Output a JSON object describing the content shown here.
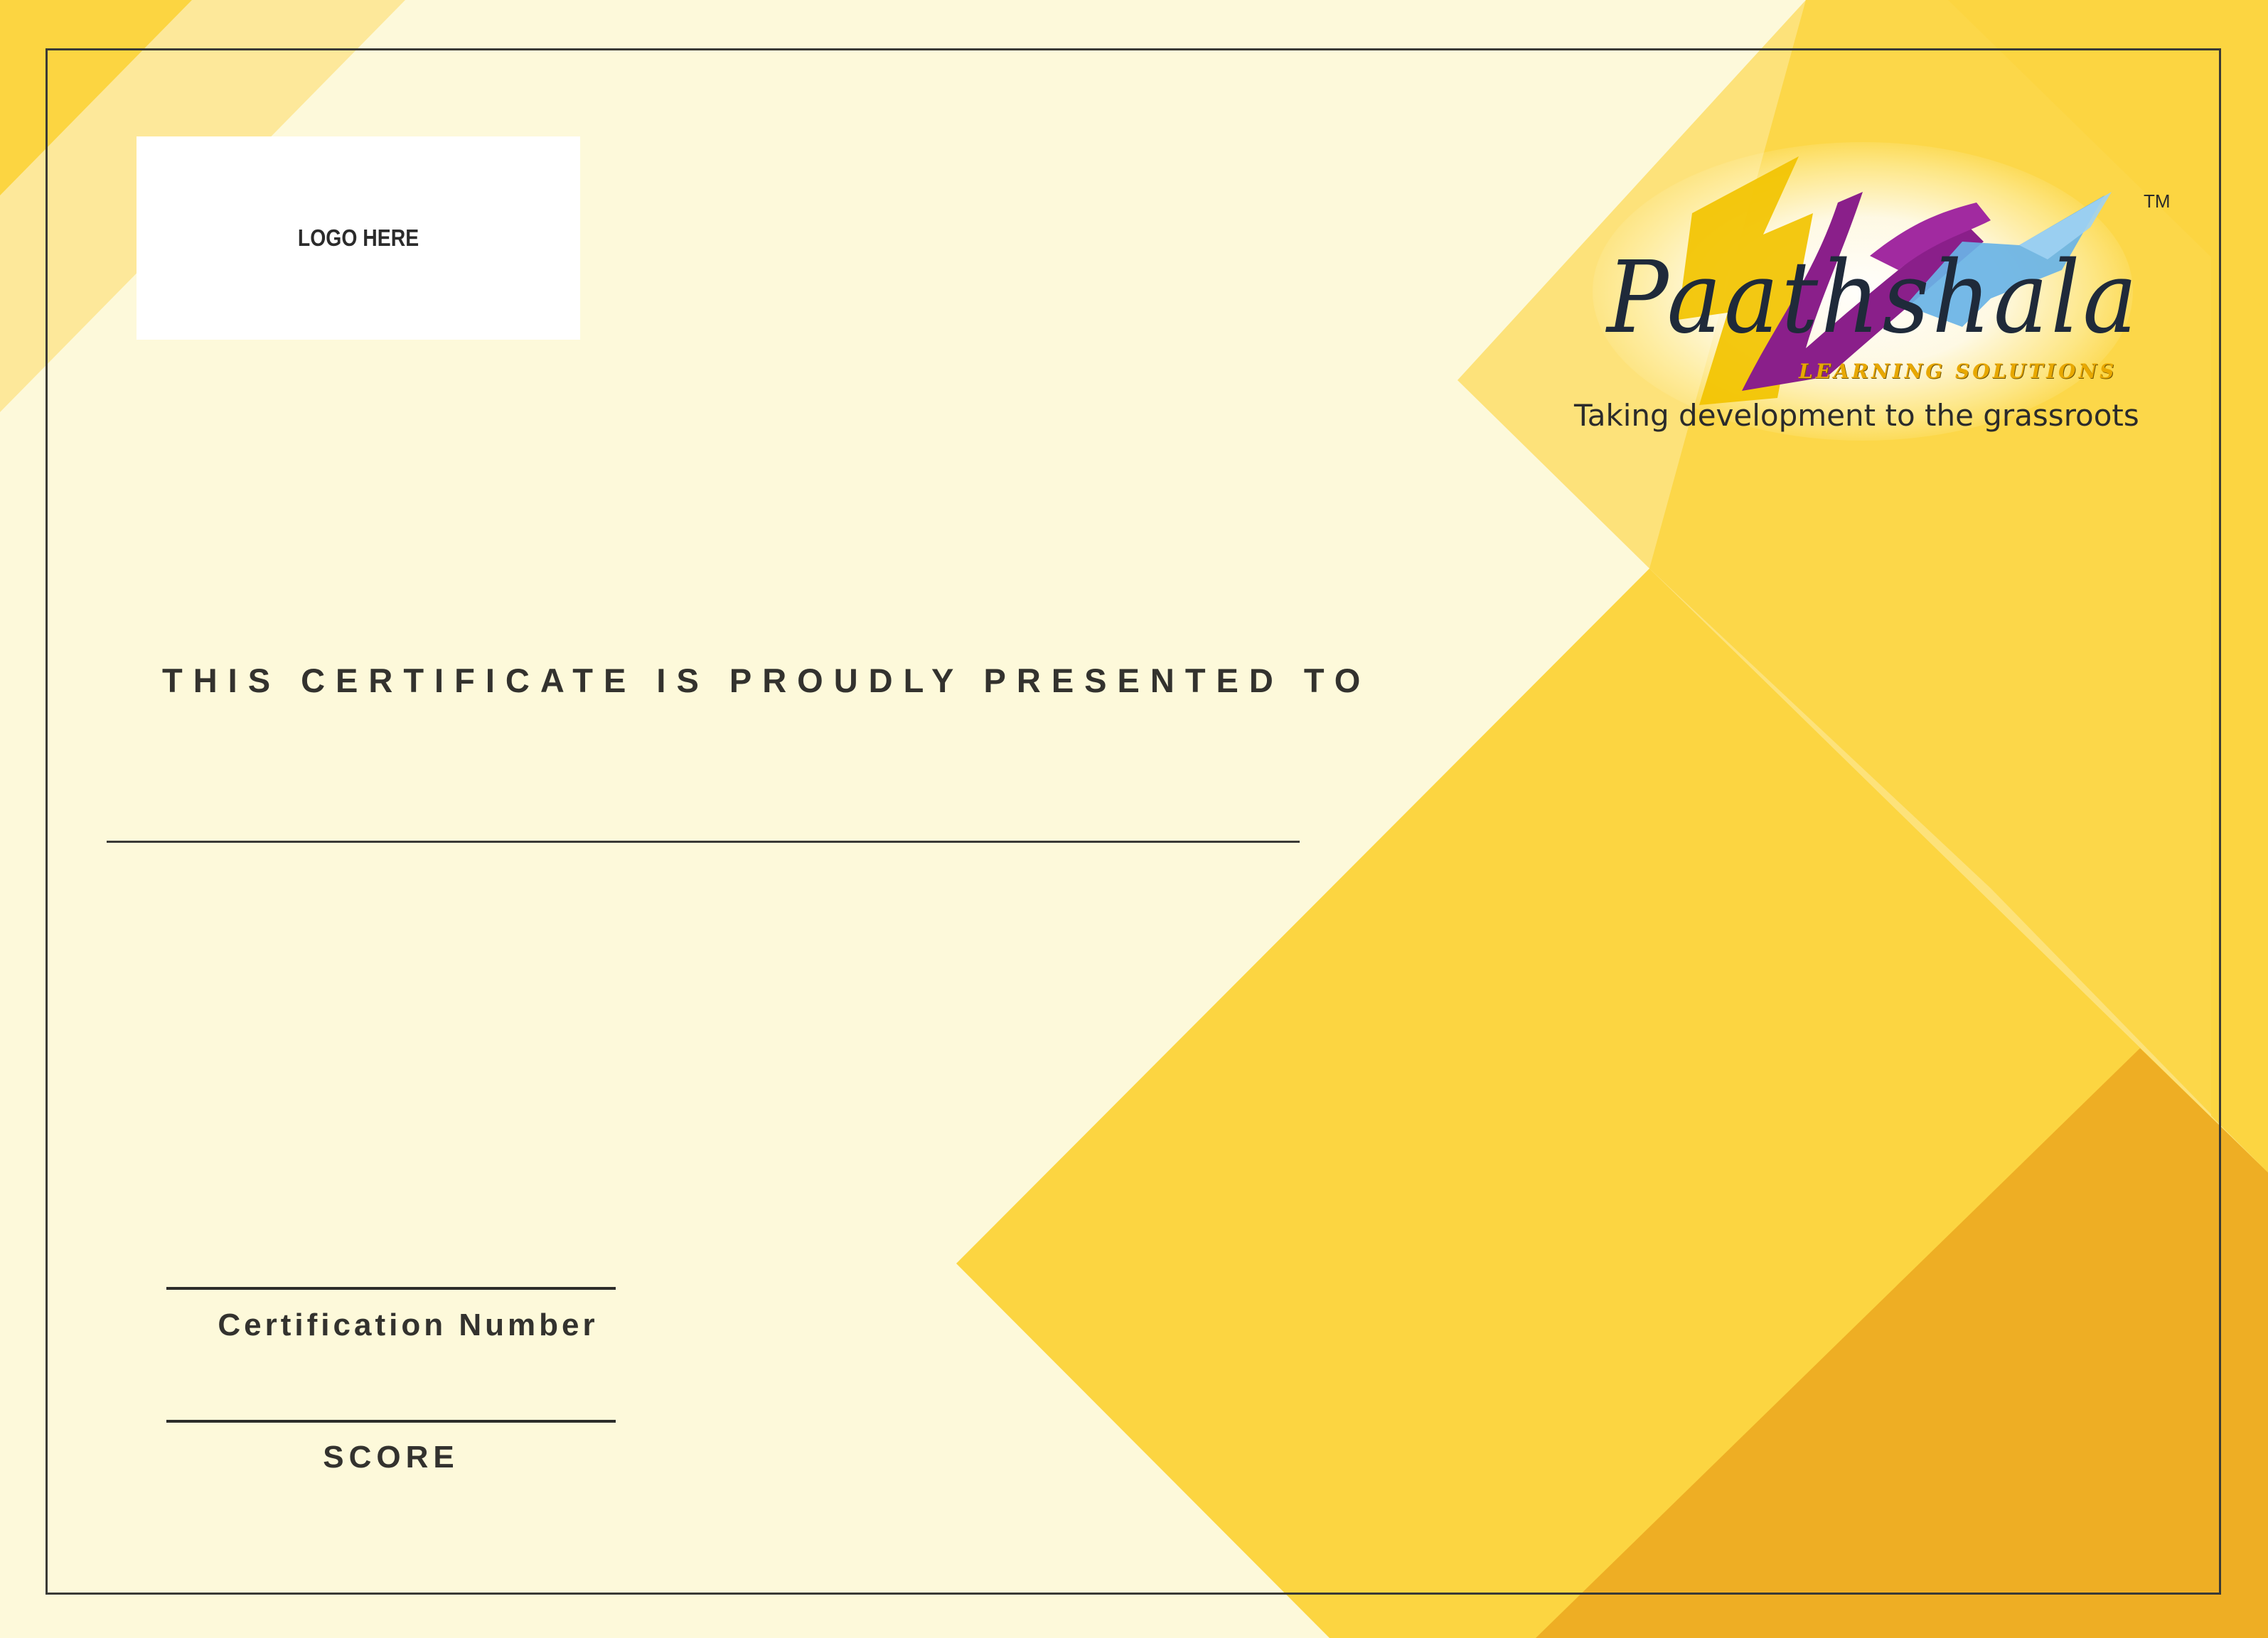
{
  "certificate": {
    "logo_placeholder": "LOGO HERE",
    "brand": {
      "name": "Paathshala",
      "subtitle": "LEARNING SOLUTIONS",
      "trademark": "TM",
      "tagline": "Taking development to the grassroots"
    },
    "presented_text": "THIS CERTIFICATE IS PROUDLY PRESENTED TO",
    "recipient_name": "",
    "certification_number_label": "Certification Number",
    "certification_number_value": "",
    "score_label": "SCORE",
    "score_value": ""
  },
  "colors": {
    "background": "#fdf9da",
    "yellow_light": "#fde89a",
    "yellow": "#fcd541",
    "yellow_deep": "#f9c22f",
    "orange": "#eeae24",
    "text": "#33322e",
    "logo_purple": "#8a1f8a",
    "logo_yellow": "#f2c300",
    "logo_blue": "#69b3e6"
  },
  "icons": {
    "brand_mark": "paathshala-logo-icon"
  }
}
